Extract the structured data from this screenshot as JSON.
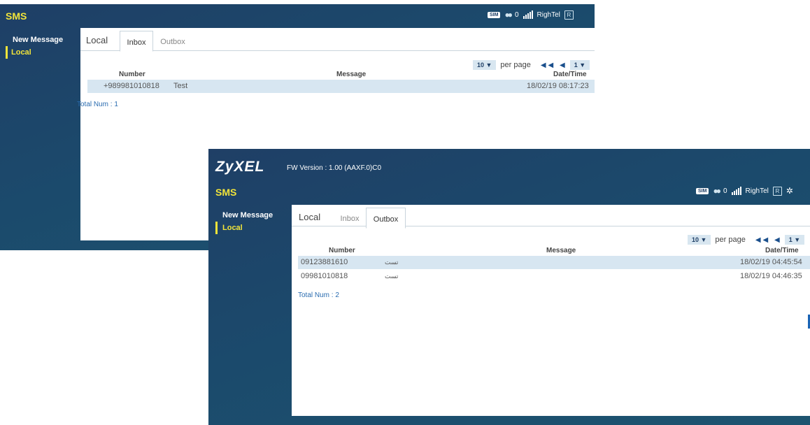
{
  "window1": {
    "sms_title": "SMS",
    "nav": [
      "New Message",
      "Local"
    ],
    "status": {
      "sim": "SIM",
      "msg_count": "0",
      "carrier": "RighTel",
      "roaming": "R"
    },
    "tabs": {
      "local": "Local",
      "inbox": "Inbox",
      "outbox": "Outbox",
      "selected": "Inbox"
    },
    "pager": {
      "per_page_value": "10 ▼",
      "per_page_label": "per page",
      "first_prev": "◀◀ ◀",
      "page": "1 ▼"
    },
    "columns": {
      "number": "Number",
      "message": "Message",
      "datetime": "Date/Time"
    },
    "rows": [
      {
        "number": "+989981010818",
        "message": "Test",
        "datetime": "18/02/19 08:17:23"
      }
    ],
    "total": "Total Num : 1"
  },
  "window2": {
    "logo": "ZyXEL",
    "fw_version": "FW Version : 1.00 (AAXF.0)C0",
    "sms_title": "SMS",
    "nav": [
      "New Message",
      "Local"
    ],
    "status": {
      "sim": "SIM",
      "msg_count": "0",
      "carrier": "RighTel",
      "roaming": "R"
    },
    "tabs": {
      "local": "Local",
      "inbox": "Inbox",
      "outbox": "Outbox",
      "selected": "Outbox"
    },
    "pager": {
      "per_page_value": "10 ▼",
      "per_page_label": "per page",
      "first_prev": "◀◀ ◀",
      "page": "1 ▼"
    },
    "columns": {
      "number": "Number",
      "message": "Message",
      "datetime": "Date/Time"
    },
    "rows": [
      {
        "number": "09123881610",
        "message": "تست",
        "datetime": "18/02/19 04:45:54"
      },
      {
        "number": "09981010818",
        "message": "تست",
        "datetime": "18/02/19 04:46:35"
      }
    ],
    "total": "Total Num : 2"
  },
  "colors": {
    "bg": "#1f3f66",
    "accent": "#f2e43a",
    "row_highlight": "#d7e6f1",
    "link": "#2a6cb0"
  }
}
